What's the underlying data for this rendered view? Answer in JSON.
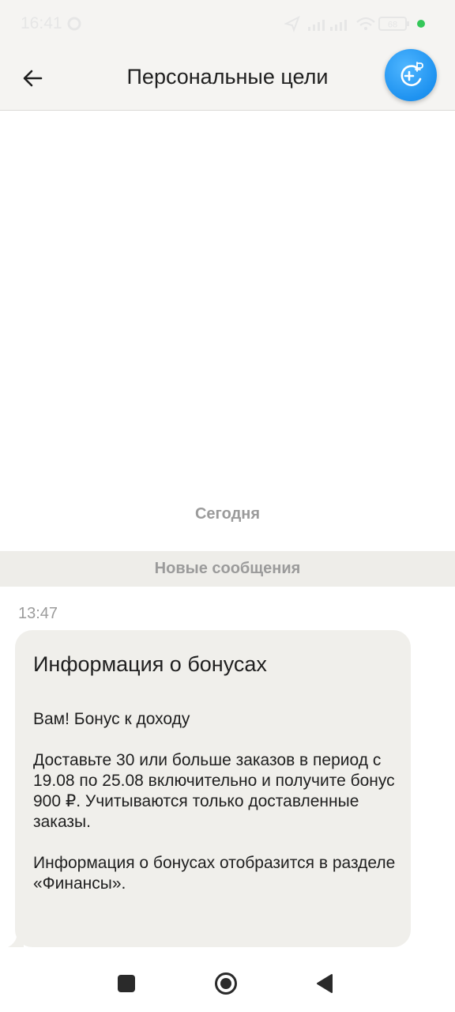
{
  "status_bar": {
    "time": "16:41",
    "battery": "68"
  },
  "header": {
    "title": "Персональные цели"
  },
  "chat": {
    "date_divider": "Сегодня",
    "new_messages_label": "Новые сообщения",
    "messages": [
      {
        "time": "13:47",
        "title": "Информация о бонусах",
        "paragraphs": [
          "Вам! Бонус к доходу",
          "Доставьте 30 или больше заказов в период с 19.08 по 25.08 включительно и получите бонус 900 ₽. Учитываются только доставленные заказы.",
          "Информация о бонусах отобразится в разделе «Финансы»."
        ]
      }
    ]
  },
  "icons": {
    "back": "arrow-left-icon",
    "bonus": "add-ruble-icon",
    "sync": "sync-icon",
    "location": "location-arrow-icon",
    "signal": "signal-icon",
    "wifi": "wifi-icon",
    "battery": "battery-icon",
    "recents": "recents-square-icon",
    "home": "home-circle-icon",
    "nav_back": "nav-back-triangle-icon"
  },
  "colors": {
    "header_bg": "#f5f4f2",
    "accent_blue": "#1e92f0",
    "bubble_bg": "#f0efeb",
    "muted_text": "#9b9b9b",
    "status_dot": "#34c759"
  }
}
